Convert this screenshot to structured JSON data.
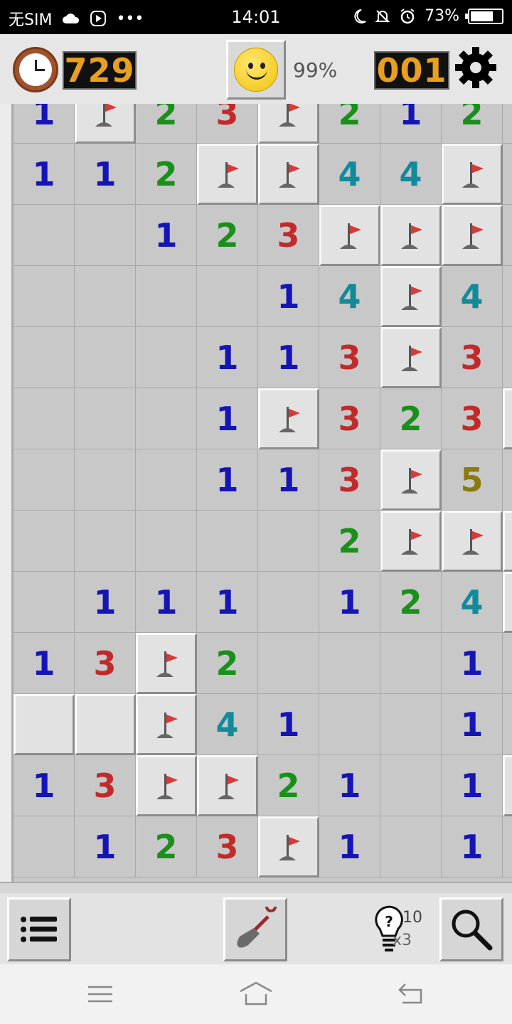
{
  "status_bar": {
    "carrier": "无SIM",
    "more": "•••",
    "time": "14:01",
    "battery": "73%",
    "battery_level": 0.73
  },
  "header": {
    "timer": "729",
    "progress_percent": "99%",
    "mine_counter": "001",
    "face": "smiley-face-icon",
    "settings_icon": "gear-icon"
  },
  "board": {
    "rows": [
      [
        "1",
        "F",
        "2",
        "3",
        "F",
        "2",
        "1",
        "2",
        ""
      ],
      [
        "1",
        "1",
        "2",
        "F",
        "F",
        "4",
        "4",
        "F",
        ""
      ],
      [
        "",
        "",
        "1",
        "2",
        "3",
        "F",
        "F",
        "F",
        ""
      ],
      [
        "",
        "",
        "",
        "",
        "1",
        "4",
        "F",
        "4",
        ""
      ],
      [
        "",
        "",
        "",
        "1",
        "1",
        "3",
        "F",
        "3",
        ""
      ],
      [
        "",
        "",
        "",
        "1",
        "F",
        "3",
        "2",
        "3",
        "U"
      ],
      [
        "",
        "",
        "",
        "1",
        "1",
        "3",
        "F",
        "5",
        ""
      ],
      [
        "",
        "",
        "",
        "",
        "",
        "2",
        "F",
        "F",
        "U"
      ],
      [
        "",
        "1",
        "1",
        "1",
        "",
        "1",
        "2",
        "4",
        "U"
      ],
      [
        "1",
        "3",
        "F",
        "2",
        "",
        "",
        "",
        "1",
        ""
      ],
      [
        "U",
        "U",
        "F",
        "4",
        "1",
        "",
        "",
        "1",
        ""
      ],
      [
        "1",
        "3",
        "F",
        "F",
        "2",
        "1",
        "",
        "1",
        "U"
      ],
      [
        "",
        "1",
        "2",
        "3",
        "F",
        "1",
        "",
        "1",
        ""
      ]
    ],
    "legend": {
      "F": "flagged",
      "U": "unrevealed",
      "": "revealed-empty"
    }
  },
  "toolbar": {
    "menu_icon": "list-menu-icon",
    "dig_icon": "shovel-icon",
    "hint_icon": "lightbulb-question-icon",
    "hints_left": "10",
    "hint_multiplier": "x3",
    "zoom_icon": "magnifier-icon"
  },
  "nav": {
    "menu_icon": "menu-lines-icon",
    "home_icon": "home-icon",
    "back_icon": "back-icon"
  },
  "colors": {
    "n1": "#1515b5",
    "n2": "#18901a",
    "n3": "#c22a2a",
    "n4": "#128a9a",
    "n5": "#8a7a10",
    "counter_digits": "#e8a020",
    "flag": "#d83a3a"
  }
}
